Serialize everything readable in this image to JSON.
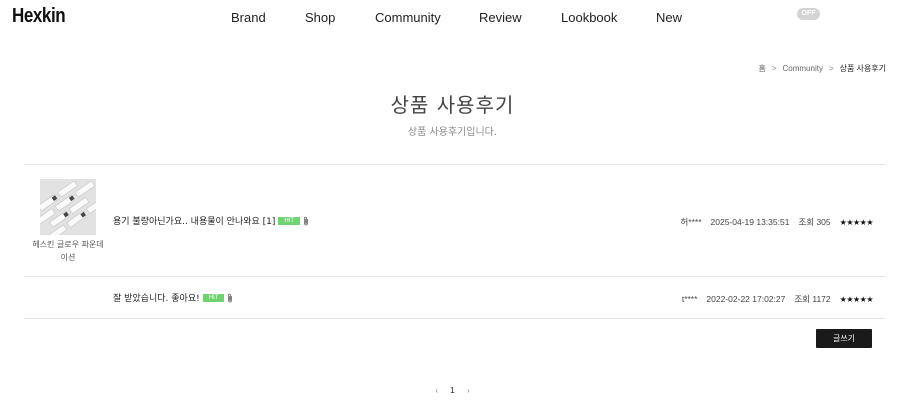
{
  "header": {
    "logo": "Hexkin",
    "nav": [
      {
        "label": "Brand",
        "name": "nav-brand"
      },
      {
        "label": "Shop",
        "name": "nav-shop"
      },
      {
        "label": "Community",
        "name": "nav-community"
      },
      {
        "label": "Review",
        "name": "nav-review"
      },
      {
        "label": "Lookbook",
        "name": "nav-lookbook"
      },
      {
        "label": "New",
        "name": "nav-new"
      }
    ],
    "toggle_label": "OFF"
  },
  "breadcrumb": {
    "home": "홈",
    "section": "Community",
    "current": "상품 사용후기"
  },
  "page": {
    "title": "상품 사용후기",
    "subtitle": "상품 사용후기입니다."
  },
  "reviews": [
    {
      "product_name": "헤스킨 글로우 파운데이션",
      "title": "용기 불량아닌가요.. 내용물이 안나와요 [1]",
      "hit_badge": "HIT",
      "attachment_icon": "paperclip-icon",
      "author": "허****",
      "date": "2025-04-19 13:35:51",
      "views": "조회 305",
      "rating": 5,
      "stars": "★★★★★"
    },
    {
      "product_name": "",
      "title": "잘 받았습니다. 좋아요!",
      "hit_badge": "HIT",
      "attachment_icon": "paperclip-icon",
      "author": "t****",
      "date": "2022-02-22 17:02:27",
      "views": "조회 1172",
      "rating": 5,
      "stars": "★★★★★"
    }
  ],
  "actions": {
    "write_label": "글쓰기"
  },
  "pagination": {
    "prev": "‹",
    "current": "1",
    "next": "›"
  },
  "colors": {
    "hit_badge": "#6fd36f",
    "write_button": "#1a1a1a",
    "toggle": "#d4d4d4"
  }
}
